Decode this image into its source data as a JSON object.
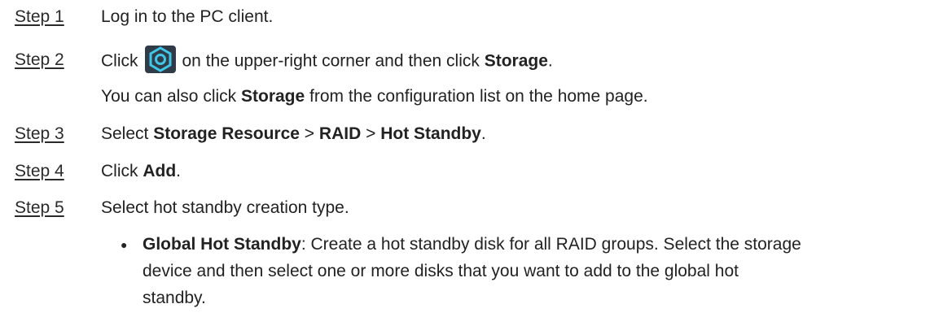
{
  "steps": [
    {
      "label": "Step 1",
      "text": "Log in to the PC client."
    },
    {
      "label": "Step 2",
      "text_pre": "Click",
      "text_mid": "on the upper-right corner and then click",
      "bold": "Storage",
      "text_end": ".",
      "sub_pre": "You can also click",
      "sub_bold": "Storage",
      "sub_post": "from the configuration list on the home page."
    },
    {
      "label": "Step 3",
      "text_pre": "Select",
      "b1": "Storage Resource",
      "sep1": ">",
      "b2": "RAID",
      "sep2": ">",
      "b3": "Hot Standby",
      "end": "."
    },
    {
      "label": "Step 4",
      "text_pre": "Click",
      "bold": "Add",
      "end": "."
    },
    {
      "label": "Step 5",
      "text": "Select hot standby creation type."
    }
  ],
  "bullet": {
    "symbol": "●",
    "bold": "Global Hot Standby",
    "line1": ": Create a hot standby disk for all RAID groups. Select the storage",
    "line2": "device and then select one or more disks that you want to add to the global hot",
    "line3": "standby."
  },
  "icon": {
    "name": "gear-icon",
    "bg": "#2f3b47",
    "ring": "#3ec7e6"
  }
}
